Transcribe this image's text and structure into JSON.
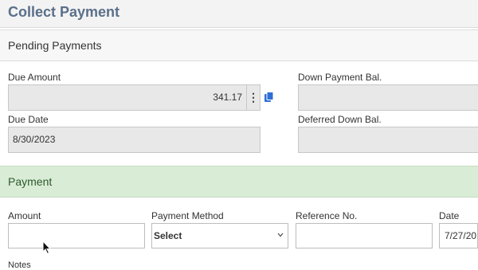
{
  "header": {
    "title": "Collect Payment"
  },
  "pending": {
    "title": "Pending Payments",
    "due_amount_label": "Due Amount",
    "due_amount_value": "341.17",
    "due_date_label": "Due Date",
    "due_date_value": "8/30/2023",
    "down_payment_label": "Down Payment Bal.",
    "deferred_label": "Deferred Down Bal.",
    "kebab": "⋮"
  },
  "payment": {
    "title": "Payment",
    "amount_label": "Amount",
    "amount_value": "",
    "method_label": "Payment Method",
    "method_value": "Select",
    "reference_label": "Reference No.",
    "reference_value": "",
    "date_label": "Date",
    "date_value": "7/27/20",
    "notes_label": "Notes"
  },
  "colors": {
    "title": "#5a6f8a",
    "payment_header_bg": "#d9ecd5",
    "copy_icon": "#2f6fd6"
  },
  "icons": {
    "copy": "copy-icon",
    "kebab": "kebab-icon",
    "chevron": "chevron-down-icon",
    "cursor": "mouse-cursor-icon"
  }
}
